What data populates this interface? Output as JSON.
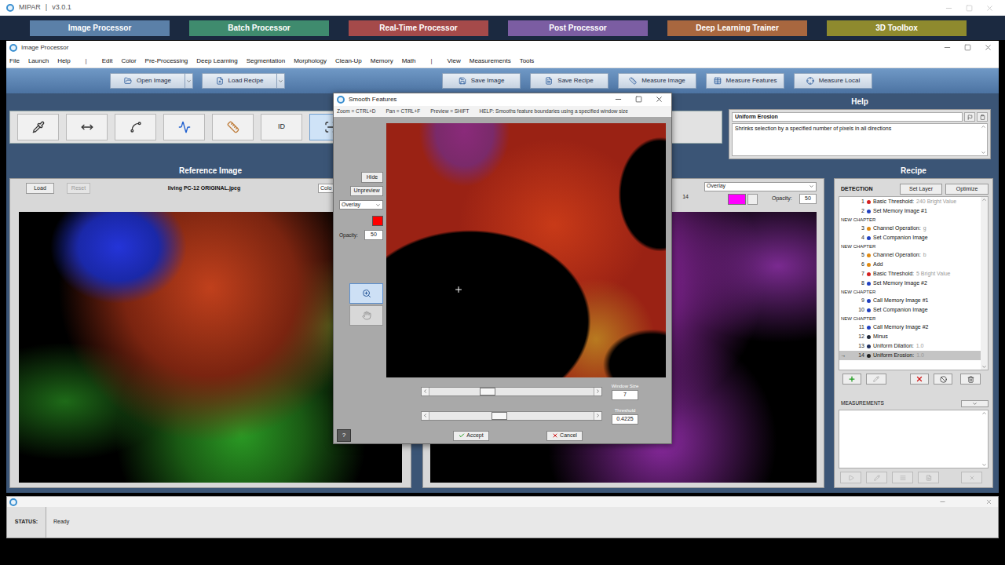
{
  "app": {
    "title": "MIPAR",
    "separator": "|",
    "version": "v3.0.1"
  },
  "modules": [
    {
      "label": "Image Processor",
      "color": "#5b80a8"
    },
    {
      "label": "Batch Processor",
      "color": "#3f8b6e"
    },
    {
      "label": "Real-Time Processor",
      "color": "#a54a4a"
    },
    {
      "label": "Post Processor",
      "color": "#7b5da2"
    },
    {
      "label": "Deep Learning Trainer",
      "color": "#a8673f"
    },
    {
      "label": "3D Toolbox",
      "color": "#8e8a2e"
    }
  ],
  "window": {
    "title": "Image Processor"
  },
  "menu": [
    {
      "kind": "item",
      "label": "File"
    },
    {
      "kind": "item",
      "label": "Launch"
    },
    {
      "kind": "item",
      "label": "Help"
    },
    {
      "kind": "separator",
      "label": "|"
    },
    {
      "kind": "item",
      "label": "Edit"
    },
    {
      "kind": "item",
      "label": "Color"
    },
    {
      "kind": "item",
      "label": "Pre-Processing"
    },
    {
      "kind": "item",
      "label": "Deep Learning"
    },
    {
      "kind": "item",
      "label": "Segmentation"
    },
    {
      "kind": "item",
      "label": "Morphology"
    },
    {
      "kind": "item",
      "label": "Clean-Up"
    },
    {
      "kind": "item",
      "label": "Memory"
    },
    {
      "kind": "item",
      "label": "Math"
    },
    {
      "kind": "separator",
      "label": "|"
    },
    {
      "kind": "item",
      "label": "View"
    },
    {
      "kind": "item",
      "label": "Measurements"
    },
    {
      "kind": "item",
      "label": "Tools"
    }
  ],
  "toolbar": {
    "left": [
      {
        "label": "Open Image",
        "dropdown": true
      },
      {
        "label": "Load Recipe",
        "dropdown": true
      }
    ],
    "right": [
      {
        "label": "Save Image",
        "dropdown": false
      },
      {
        "label": "Save Recipe",
        "dropdown": false
      },
      {
        "label": "Measure Image",
        "dropdown": false
      },
      {
        "label": "Measure Features",
        "dropdown": false
      },
      {
        "label": "Measure Local",
        "dropdown": false
      }
    ]
  },
  "tools": [
    {
      "kind": "icon",
      "label": "",
      "selected": false
    },
    {
      "kind": "icon",
      "label": "",
      "selected": false
    },
    {
      "kind": "icon",
      "label": "",
      "selected": false
    },
    {
      "kind": "icon",
      "label": "",
      "selected": false
    },
    {
      "kind": "icon",
      "label": "",
      "selected": false
    },
    {
      "kind": "text",
      "label": "ID",
      "selected": false
    },
    {
      "kind": "icon",
      "label": "",
      "selected": true
    }
  ],
  "help": {
    "title": "Help",
    "topic": "Uniform Erosion",
    "text": "Shrinks selection by a specified number of pixels in all directions"
  },
  "reference": {
    "title": "Reference Image",
    "load": "Load",
    "reset": {
      "label": "Reset",
      "disabled": true
    },
    "filename": "living PC-12 ORIGINAL.jpeg",
    "display": "Colo"
  },
  "result": {
    "count": "14",
    "display": "Overlay",
    "overlay_color": "#ff00ff",
    "opacity_label": "Opacity:",
    "opacity": "50"
  },
  "recipe": {
    "title": "Recipe",
    "layer": "DETECTION",
    "set_layer": "Set Layer",
    "optimize": "Optimize",
    "steps": [
      {
        "kind": "step",
        "marker": "",
        "number": "1",
        "name": "Basic Threshold:",
        "param": "240 Bright Value",
        "color": "#d42020",
        "selected": false
      },
      {
        "kind": "step",
        "marker": "",
        "number": "2",
        "name": "Set Memory Image #1",
        "param": "",
        "color": "#2040c0",
        "selected": false
      },
      {
        "kind": "chapter",
        "label": "NEW CHAPTER"
      },
      {
        "kind": "step",
        "marker": "",
        "number": "3",
        "name": "Channel Operation:",
        "param": "g",
        "color": "#e08a10",
        "selected": false
      },
      {
        "kind": "step",
        "marker": "",
        "number": "4",
        "name": "Set Companion Image",
        "param": "",
        "color": "#2040c0",
        "selected": false
      },
      {
        "kind": "chapter",
        "label": "NEW CHAPTER"
      },
      {
        "kind": "step",
        "marker": "",
        "number": "5",
        "name": "Channel Operation:",
        "param": "b",
        "color": "#e08a10",
        "selected": false
      },
      {
        "kind": "step",
        "marker": "",
        "number": "6",
        "name": "Add",
        "param": "",
        "color": "#e08a10",
        "selected": false
      },
      {
        "kind": "step",
        "marker": "",
        "number": "7",
        "name": "Basic Threshold:",
        "param": "5 Bright Value",
        "color": "#d42020",
        "selected": false
      },
      {
        "kind": "step",
        "marker": "",
        "number": "8",
        "name": "Set Memory Image #2",
        "param": "",
        "color": "#2040c0",
        "selected": false
      },
      {
        "kind": "chapter",
        "label": "NEW CHAPTER"
      },
      {
        "kind": "step",
        "marker": "",
        "number": "9",
        "name": "Call Memory Image #1",
        "param": "",
        "color": "#2040c0",
        "selected": false
      },
      {
        "kind": "step",
        "marker": "",
        "number": "10",
        "name": "Set Companion Image",
        "param": "",
        "color": "#2040c0",
        "selected": false
      },
      {
        "kind": "chapter",
        "label": "NEW CHAPTER"
      },
      {
        "kind": "step",
        "marker": "",
        "number": "11",
        "name": "Call Memory Image #2",
        "param": "",
        "color": "#2040c0",
        "selected": false
      },
      {
        "kind": "step",
        "marker": "",
        "number": "12",
        "name": "Minus",
        "param": "",
        "color": "#202838",
        "selected": false
      },
      {
        "kind": "step",
        "marker": "",
        "number": "13",
        "name": "Uniform Dilation:",
        "param": "1.0",
        "color": "#203060",
        "selected": false
      },
      {
        "kind": "step",
        "marker": "→",
        "number": "14",
        "name": "Uniform Erosion:",
        "param": "1.0",
        "color": "#202020",
        "selected": true
      }
    ],
    "measurements": {
      "title": "MEASUREMENTS",
      "buttons": [
        {
          "disabled": true
        },
        {
          "disabled": true
        },
        {
          "disabled": true
        },
        {
          "disabled": true
        },
        {
          "disabled": true
        }
      ]
    }
  },
  "dialog": {
    "title": "Smooth Features",
    "hints": [
      "Zoom = CTRL+D",
      "Pan = CTRL+F",
      "Preview = SHIFT",
      "HELP: Smooths feature boundaries using a specified window size"
    ],
    "hide": "Hide",
    "unpreview": "Unpreview",
    "display": "Overlay",
    "overlay_color": "#ff0000",
    "opacity_label": "Opacity:",
    "opacity": "50",
    "nav_tools": [
      {
        "selected": true
      },
      {
        "selected": false
      }
    ],
    "sliders": [
      {
        "label": "Window Size",
        "value": "7",
        "level": 0.34
      },
      {
        "label": "Threshold",
        "value": "0.4225",
        "level": 0.42
      }
    ],
    "help_button": "?",
    "accept": "Accept",
    "cancel": "Cancel"
  },
  "status": {
    "label": "STATUS:",
    "value": "Ready"
  }
}
